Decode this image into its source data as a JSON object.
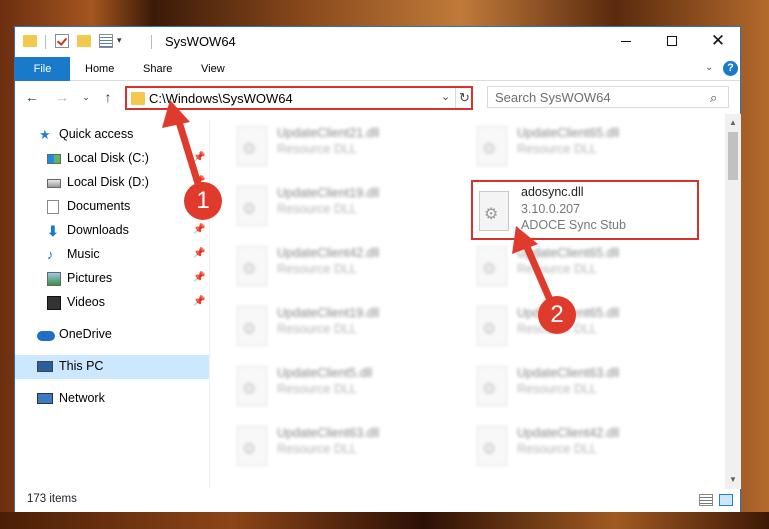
{
  "window": {
    "title": "SysWOW64",
    "controls": {
      "minimize": "minimize",
      "maximize": "maximize",
      "close": "✕"
    }
  },
  "ribbon": {
    "tabs": [
      "File",
      "Home",
      "Share",
      "View"
    ],
    "help": "?"
  },
  "address": {
    "path": "C:\\Windows\\SysWOW64",
    "refresh": "↻",
    "dropdown": "⌄"
  },
  "search": {
    "placeholder": "Search SysWOW64",
    "icon": "⌕"
  },
  "nav": {
    "back": "←",
    "forward": "→",
    "recent": "⌄",
    "up": "↑"
  },
  "sidebar": {
    "items": [
      {
        "label": "Quick access",
        "icon": "star-icon",
        "pinned": false
      },
      {
        "label": "Local Disk (C:)",
        "icon": "drive-icon",
        "pinned": true
      },
      {
        "label": "Local Disk (D:)",
        "icon": "drive-icon",
        "pinned": true
      },
      {
        "label": "Documents",
        "icon": "documents-icon",
        "pinned": true
      },
      {
        "label": "Downloads",
        "icon": "downloads-icon",
        "pinned": true
      },
      {
        "label": "Music",
        "icon": "music-icon",
        "pinned": true
      },
      {
        "label": "Pictures",
        "icon": "pictures-icon",
        "pinned": true
      },
      {
        "label": "Videos",
        "icon": "videos-icon",
        "pinned": true
      },
      {
        "label": "OneDrive",
        "icon": "onedrive-icon",
        "pinned": false
      },
      {
        "label": "This PC",
        "icon": "this-pc-icon",
        "pinned": false,
        "selected": true
      },
      {
        "label": "Network",
        "icon": "network-icon",
        "pinned": false
      }
    ]
  },
  "files": {
    "left": [
      {
        "name": "UpdateClient21.dll",
        "type": "Resource DLL"
      },
      {
        "name": "UpdateClient19.dll",
        "type": "Resource DLL"
      },
      {
        "name": "UpdateClient42.dll",
        "type": "Resource DLL"
      },
      {
        "name": "UpdateClient19.dll",
        "type": "Resource DLL"
      },
      {
        "name": "UpdateClient5.dll",
        "type": "Resource DLL"
      },
      {
        "name": "UpdateClient63.dll",
        "type": "Resource DLL"
      }
    ],
    "right": [
      {
        "name": "UpdateClient65.dll",
        "type": "Resource DLL"
      },
      {
        "name": "adosync.dll",
        "type": "3.10.0.207",
        "desc": "ADOCE Sync Stub",
        "highlighted": true
      },
      {
        "name": "UpdateClient65.dll",
        "type": "Resource DLL"
      },
      {
        "name": "UpdateClient65.dll",
        "type": "Resource DLL"
      },
      {
        "name": "UpdateClient63.dll",
        "type": "Resource DLL"
      },
      {
        "name": "UpdateClient42.dll",
        "type": "Resource DLL"
      }
    ]
  },
  "status": {
    "item_count": "173 items"
  },
  "annotations": {
    "step1": "1",
    "step2": "2",
    "color": "#e03a2c"
  },
  "colors": {
    "accent": "#1979ca",
    "highlight": "#d9322c",
    "selection": "#cce8ff"
  }
}
